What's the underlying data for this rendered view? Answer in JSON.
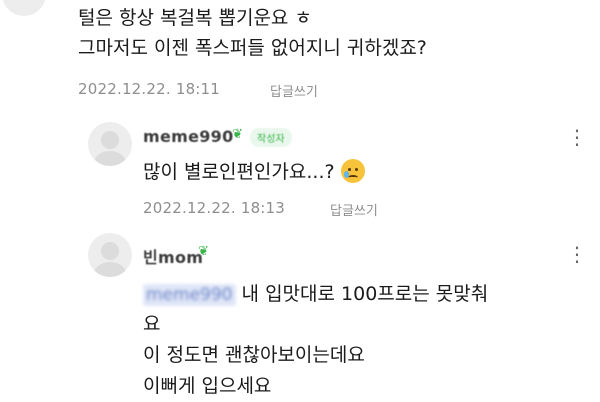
{
  "comments": [
    {
      "text_lines": [
        "털은 항상 복걸복 뽑기운요 ㅎ",
        "그마저도 이젠 폭스퍼들 없어지니 귀하겠죠?"
      ],
      "date": "2022.12.22. 18:11",
      "reply_label": "답글쓰기"
    },
    {
      "username": "meme990",
      "level_icon": "sprout-icon",
      "badge": "작성자",
      "text": "많이 별로인편인가요...?",
      "emoji": "crying-face",
      "date": "2022.12.22. 18:13",
      "reply_label": "답글쓰기",
      "more_label": "⋮"
    },
    {
      "username": "빈mom",
      "level_icon": "sprout-icon",
      "mention": "meme990",
      "text_lines": [
        "내 입맛대로 100프로는 못맞춰",
        "요",
        "이 정도면 괜찮아보이는데요",
        "이뻐게 입으세요"
      ],
      "more_label": "⋮"
    }
  ],
  "colors": {
    "text": "#1b1b1b",
    "meta": "#8e8e8e",
    "badge": "#39b54a",
    "mention": "#6e86c8"
  }
}
